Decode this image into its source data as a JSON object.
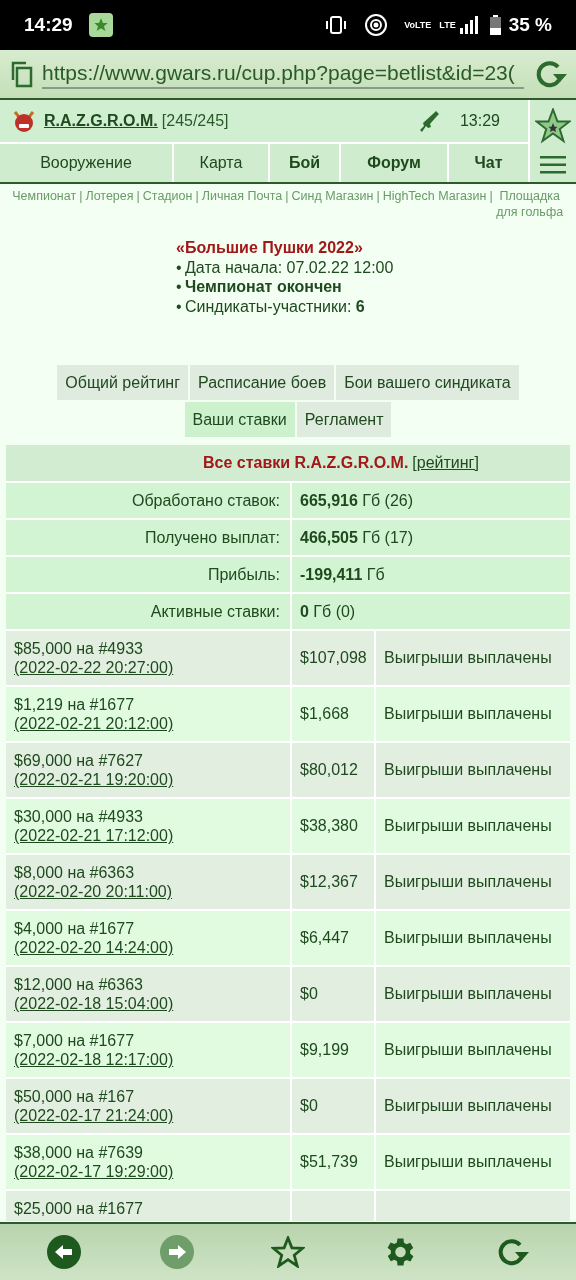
{
  "status_bar": {
    "time": "14:29",
    "volte": "VoLTE",
    "network": "LTE",
    "battery": "35 %"
  },
  "address_bar": {
    "url": "https://www.gwars.ru/cup.php?page=betlist&id=23("
  },
  "header": {
    "syndicate": "R.A.Z.G.R.O.M.",
    "count": "[245/245]",
    "time": "13:29"
  },
  "nav_tabs": [
    {
      "label": "Вооружение",
      "bold": false
    },
    {
      "label": "Карта",
      "bold": false
    },
    {
      "label": "Бой",
      "bold": true
    },
    {
      "label": "Форум",
      "bold": true
    },
    {
      "label": "Чат",
      "bold": true
    }
  ],
  "link_separator": "|",
  "links": [
    "Чемпионат",
    "Лотерея",
    "Стадион",
    "Личная Почта",
    "Синд Магазин",
    "HighTech Магазин",
    "Площадка для гольфа"
  ],
  "championship": {
    "title": "«Большие Пушки 2022»",
    "bullet": "•",
    "lines": [
      "Дата начала: 07.02.22 12:00",
      "**Чемпионат окончен**",
      "Синдикаты-участники: **6**"
    ]
  },
  "page_tabs": [
    {
      "label": "Общий рейтинг",
      "selected": false
    },
    {
      "label": "Расписание боев",
      "selected": false
    },
    {
      "label": "Бои вашего синдиката",
      "selected": false
    },
    {
      "label": "Ваши ставки",
      "selected": true
    },
    {
      "label": "Регламент",
      "selected": false
    }
  ],
  "table": {
    "title": "Все ставки R.A.Z.G.R.O.M.",
    "rating_link": "[рейтинг]",
    "summary": [
      {
        "label": "Обработано ставок:",
        "value": "**665,916** Гб (26)"
      },
      {
        "label": "Получено выплат:",
        "value": "**466,505** Гб (17)"
      },
      {
        "label": "Прибыль:",
        "value": "**-199,411** Гб"
      },
      {
        "label": "Активные ставки:",
        "value": "**0** Гб (0)"
      }
    ],
    "bets": [
      {
        "stake": "$85,000 на #4933",
        "date": "(2022-02-22 20:27:00)",
        "payout": "$107,098",
        "status": "Выигрыши выплачены"
      },
      {
        "stake": "$1,219 на #1677",
        "date": "(2022-02-21 20:12:00)",
        "payout": "$1,668",
        "status": "Выигрыши выплачены"
      },
      {
        "stake": "$69,000 на #7627",
        "date": "(2022-02-21 19:20:00)",
        "payout": "$80,012",
        "status": "Выигрыши выплачены"
      },
      {
        "stake": "$30,000 на #4933",
        "date": "(2022-02-21 17:12:00)",
        "payout": "$38,380",
        "status": "Выигрыши выплачены"
      },
      {
        "stake": "$8,000 на #6363",
        "date": "(2022-02-20 20:11:00)",
        "payout": "$12,367",
        "status": "Выигрыши выплачены"
      },
      {
        "stake": "$4,000 на #1677",
        "date": "(2022-02-20 14:24:00)",
        "payout": "$6,447",
        "status": "Выигрыши выплачены"
      },
      {
        "stake": "$12,000 на #6363",
        "date": "(2022-02-18 15:04:00)",
        "payout": "$0",
        "status": "Выигрыши выплачены"
      },
      {
        "stake": "$7,000 на #1677",
        "date": "(2022-02-18 12:17:00)",
        "payout": "$9,199",
        "status": "Выигрыши выплачены"
      },
      {
        "stake": "$50,000 на #167",
        "date": "(2022-02-17 21:24:00)",
        "payout": "$0",
        "status": "Выигрыши выплачены"
      },
      {
        "stake": "$38,000 на #7639",
        "date": "(2022-02-17 19:29:00)",
        "payout": "$51,739",
        "status": "Выигрыши выплачены"
      },
      {
        "stake": "$25,000 на #1677"
      }
    ]
  },
  "bottom_bar": {
    "forward_disabled": true
  }
}
